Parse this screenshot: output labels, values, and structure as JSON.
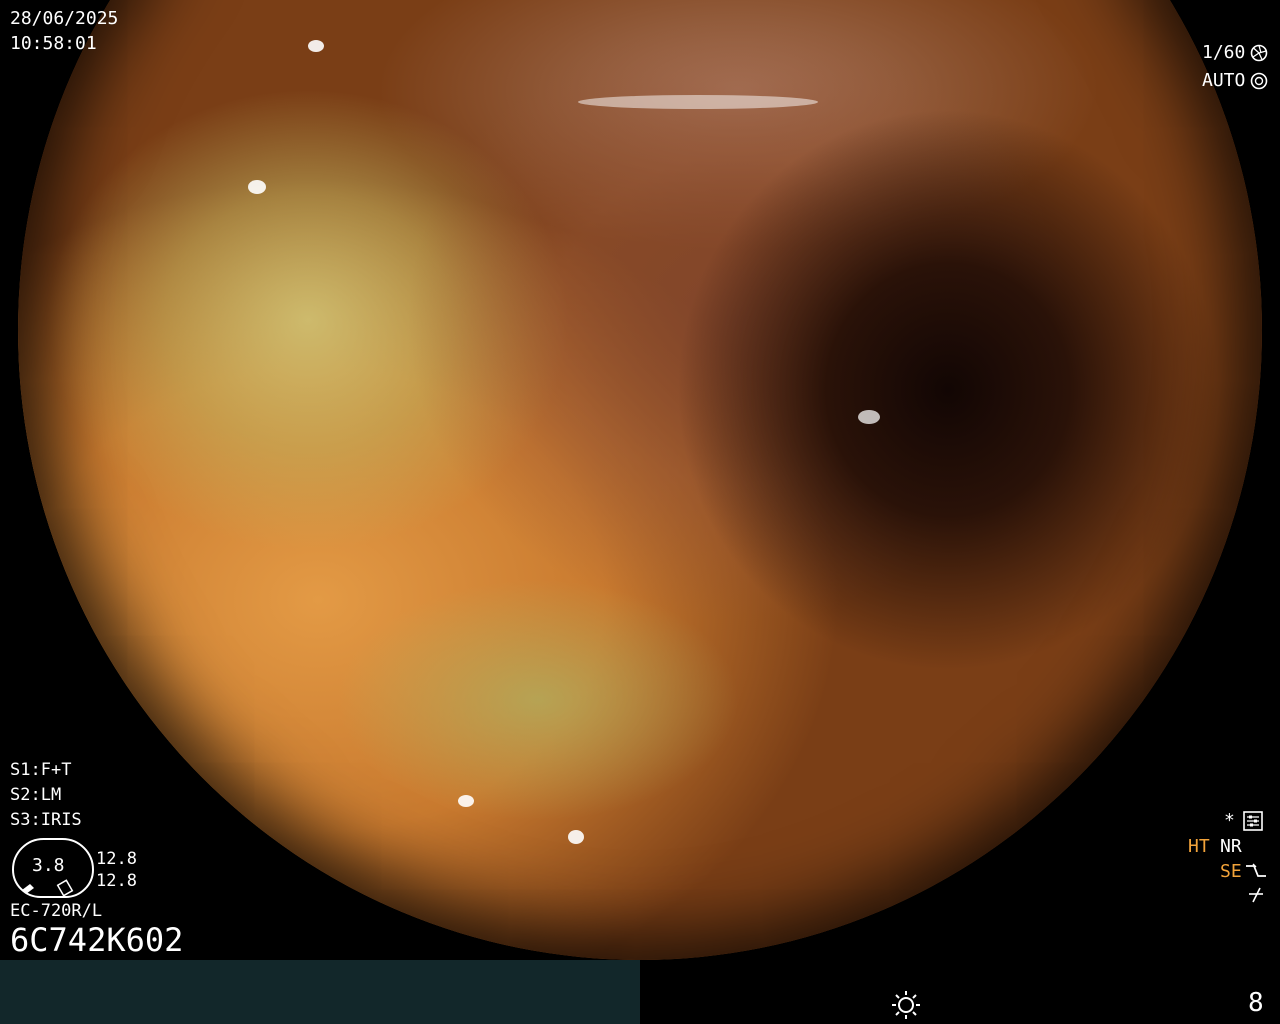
{
  "header": {
    "date": "28/06/2025",
    "time": "10:58:01",
    "shutter": "1/60",
    "shutter_icon": "shutter-icon",
    "exposure_mode": "AUTO",
    "exposure_icon": "camera-icon"
  },
  "settings": {
    "s1_label": "S1:",
    "s1_value": "F+T",
    "s2_label": "S2:",
    "s2_value": "LM",
    "s3_label": "S3:",
    "s3_value": "IRIS"
  },
  "gauge": {
    "value": "3.8",
    "upper": "12.8",
    "lower": "12.8"
  },
  "device": {
    "model": "EC-720R/L",
    "serial": "6C742K602"
  },
  "indicators": {
    "star": "*",
    "star_icon": "settings-icon",
    "ht": "HT",
    "nr": "NR",
    "se": "SE",
    "se_icon": "enhance-icon",
    "last_icon": "disabled-icon",
    "accent_color": "#f2a33a"
  },
  "status_bar": {
    "brightness_icon": "brightness-icon",
    "page_number": "8",
    "left_color": "#12272a"
  }
}
